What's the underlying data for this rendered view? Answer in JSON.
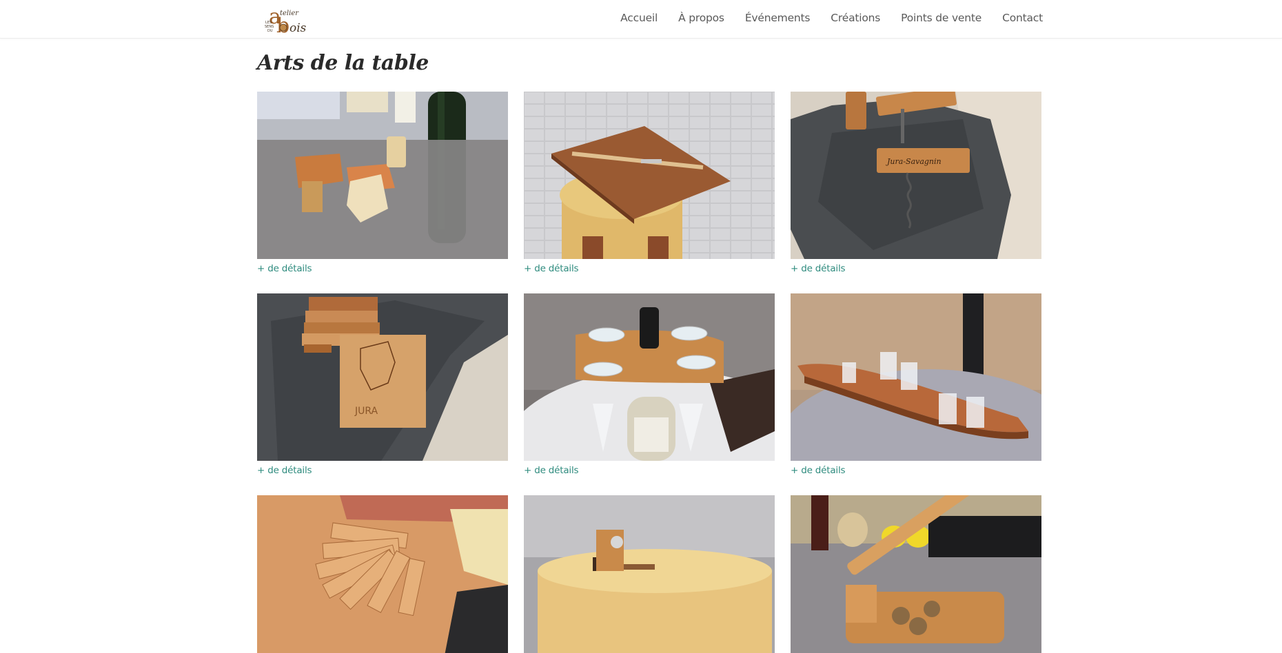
{
  "site": {
    "logo_alt": "Atelier Les Sens du Bois"
  },
  "nav": {
    "items": [
      {
        "label": "Accueil"
      },
      {
        "label": "À propos"
      },
      {
        "label": "Événements"
      },
      {
        "label": "Créations"
      },
      {
        "label": "Points de vente"
      },
      {
        "label": "Contact"
      }
    ]
  },
  "page": {
    "title": "Arts de la table"
  },
  "products": {
    "details_label": "+ de détails",
    "items": [
      {
        "image": "wine-stoppers-photo"
      },
      {
        "image": "cutting-board-photo"
      },
      {
        "image": "corkscrews-photo"
      },
      {
        "image": "coasters-photo"
      },
      {
        "image": "wine-glass-holder-photo"
      },
      {
        "image": "shot-glass-board-photo"
      },
      {
        "image": "cheese-markers-photo"
      },
      {
        "image": "bottle-opener-photo"
      },
      {
        "image": "nutcracker-photo"
      }
    ]
  }
}
